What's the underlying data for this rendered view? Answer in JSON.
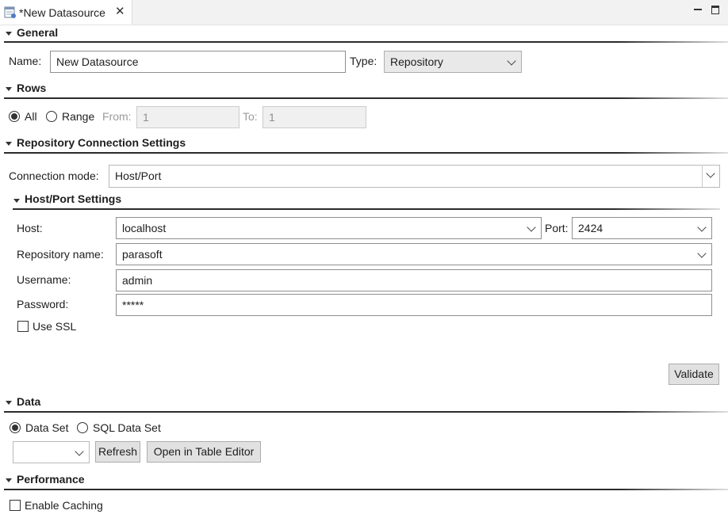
{
  "tab": {
    "title": "*New Datasource",
    "icon": "datasource-icon"
  },
  "general": {
    "header": "General",
    "name_label": "Name:",
    "name_value": "New Datasource",
    "type_label": "Type:",
    "type_value": "Repository"
  },
  "rows": {
    "header": "Rows",
    "all_label": "All",
    "range_label": "Range",
    "from_label": "From:",
    "from_value": "1",
    "to_label": "To:",
    "to_value": "1",
    "selected": "All"
  },
  "repo": {
    "header": "Repository Connection Settings",
    "mode_label": "Connection mode:",
    "mode_value": "Host/Port"
  },
  "hostport": {
    "header": "Host/Port Settings",
    "host_label": "Host:",
    "host_value": "localhost",
    "port_label": "Port:",
    "port_value": "2424",
    "repo_label": "Repository name:",
    "repo_value": "parasoft",
    "user_label": "Username:",
    "user_value": "admin",
    "pass_label": "Password:",
    "pass_value": "*****",
    "ssl_label": "Use SSL",
    "validate_label": "Validate"
  },
  "data": {
    "header": "Data",
    "dataset_label": "Data Set",
    "sql_label": "SQL Data Set",
    "selected": "Data Set",
    "refresh_label": "Refresh",
    "open_editor_label": "Open in Table Editor"
  },
  "performance": {
    "header": "Performance",
    "caching_label": "Enable Caching"
  }
}
